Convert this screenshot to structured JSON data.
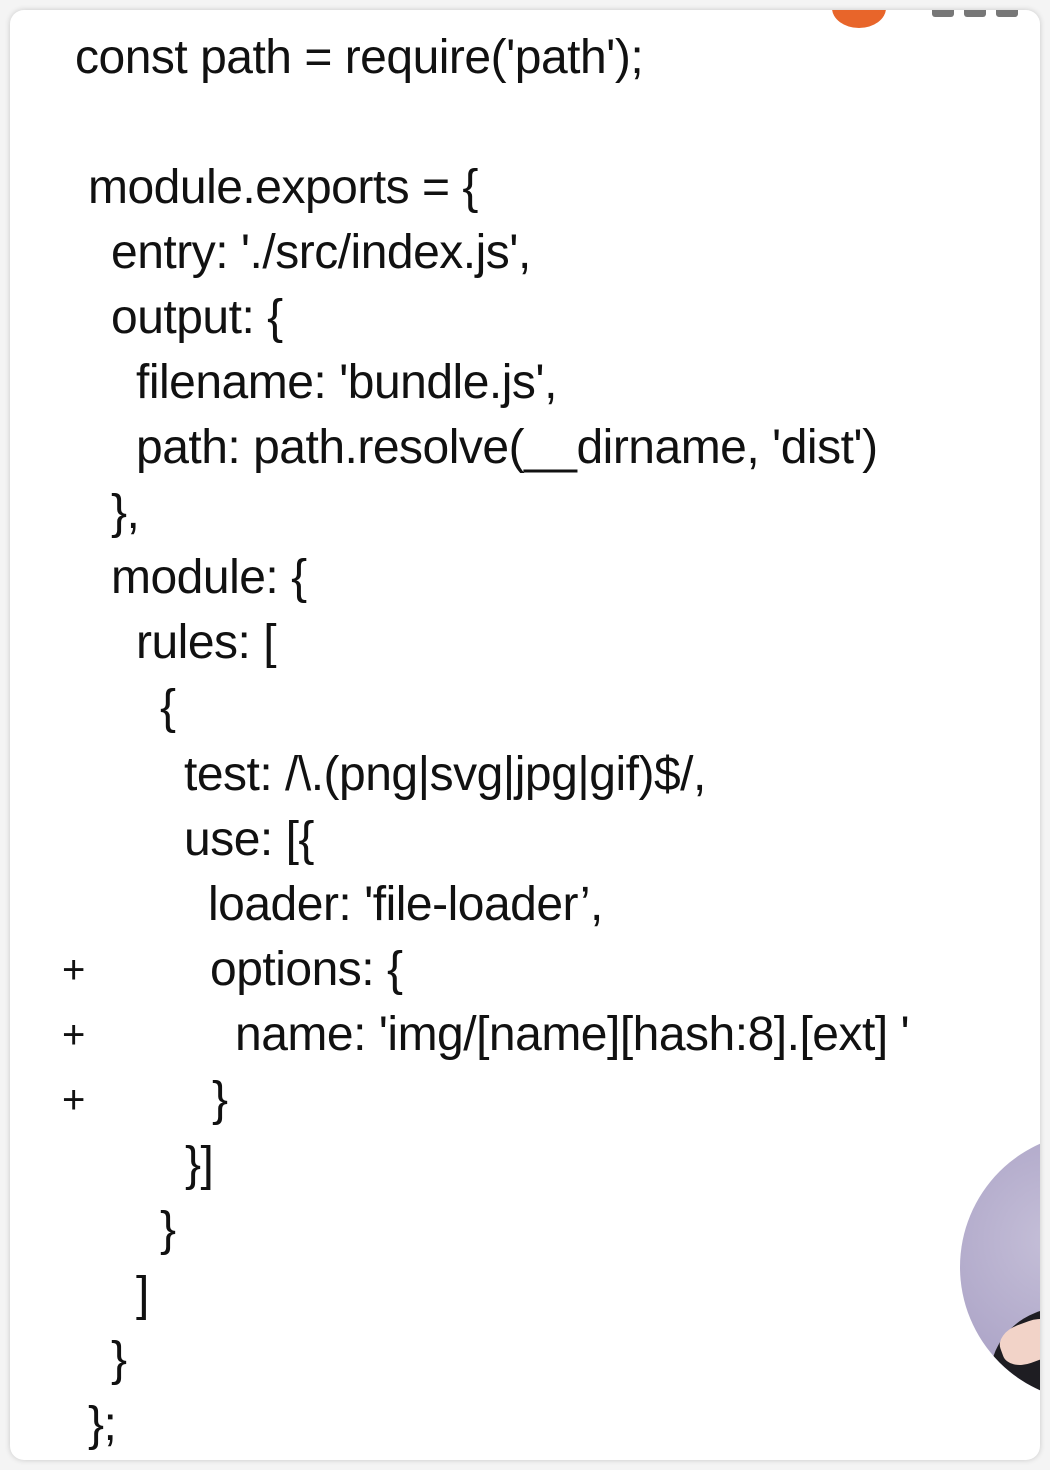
{
  "code": {
    "lines": [
      "const path = require('path');",
      "module.exports = {",
      "entry: './src/index.js',",
      "output: {",
      "filename: 'bundle.js',",
      "path: path.resolve(__dirname, 'dist')",
      "},",
      "module: {",
      "rules: [",
      "{",
      "test: /\\.(png|svg|jpg|gif)$/,",
      "use: [{",
      "loader: 'file-loader’,",
      "options: {",
      "name: 'img/[name][hash:8].[ext] '",
      "}",
      "}]",
      "}",
      "]",
      "}",
      "};"
    ],
    "diff_markers": [
      "+",
      "+",
      "+"
    ]
  },
  "colors": {
    "text": "#111111",
    "background": "#ffffff",
    "logo_accent": "#e8652a"
  }
}
